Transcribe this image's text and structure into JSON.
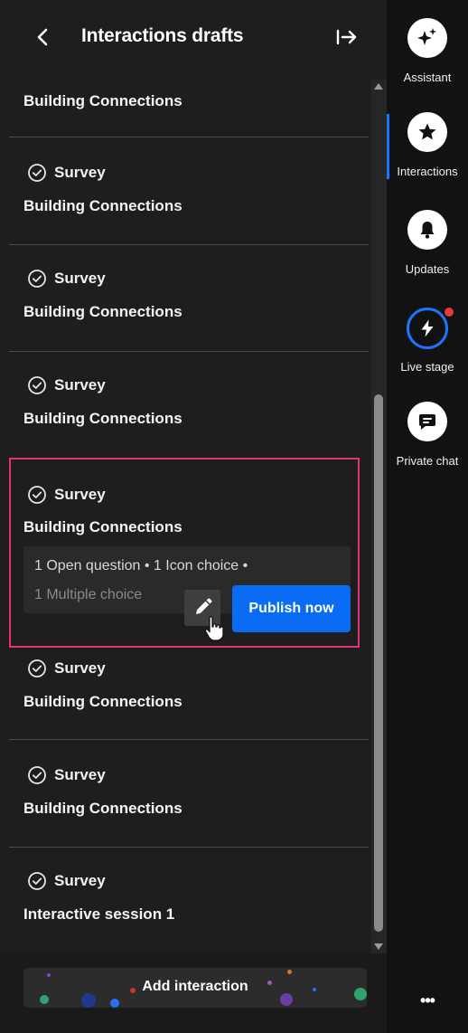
{
  "header": {
    "title": "Interactions drafts"
  },
  "items": [
    {
      "type": "",
      "title": "Building Connections"
    },
    {
      "type": "Survey",
      "title": "Building Connections"
    },
    {
      "type": "Survey",
      "title": "Building Connections"
    },
    {
      "type": "Survey",
      "title": "Building Connections"
    },
    {
      "type": "Survey",
      "title": "Building Connections"
    },
    {
      "type": "Survey",
      "title": "Building Connections"
    },
    {
      "type": "Survey",
      "title": "Building Connections"
    },
    {
      "type": "Survey",
      "title": "Interactive session 1"
    }
  ],
  "selected": {
    "summary_line1": "1 Open question  •  1 Icon choice  •",
    "summary_line2": "1 Multiple choice",
    "publish_label": "Publish now"
  },
  "footer": {
    "add_label": "Add interaction"
  },
  "rail": {
    "items": [
      {
        "label": "Assistant",
        "icon": "sparkle-icon"
      },
      {
        "label": "Interactions",
        "icon": "star-icon"
      },
      {
        "label": "Updates",
        "icon": "bell-icon"
      },
      {
        "label": "Live stage",
        "icon": "lightning-icon"
      },
      {
        "label": "Private chat",
        "icon": "chat-icon"
      }
    ],
    "more": "•••"
  },
  "colors": {
    "accent": "#0a6cf5",
    "highlight": "#e2337a",
    "live_dot": "#e23b3b"
  }
}
